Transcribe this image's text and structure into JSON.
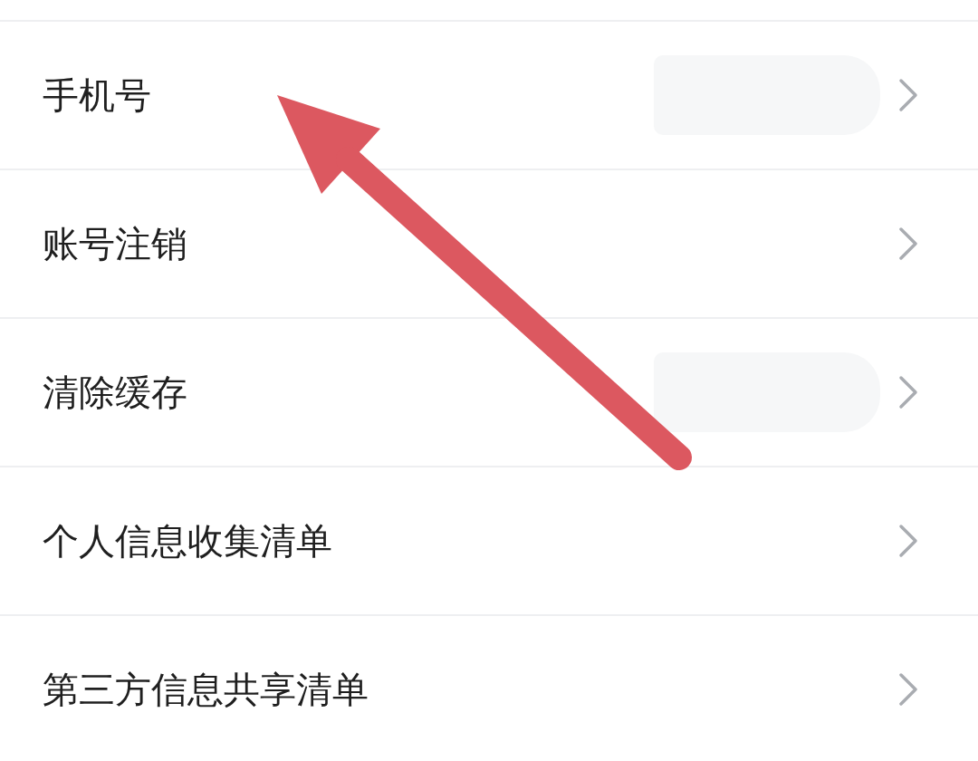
{
  "rows": [
    {
      "label": "手机号",
      "redacted": true
    },
    {
      "label": "账号注销",
      "redacted": false
    },
    {
      "label": "清除缓存",
      "redacted": true
    },
    {
      "label": "个人信息收集清单",
      "redacted": false
    },
    {
      "label": "第三方信息共享清单",
      "redacted": false
    }
  ],
  "annotation": {
    "kind": "arrow"
  }
}
